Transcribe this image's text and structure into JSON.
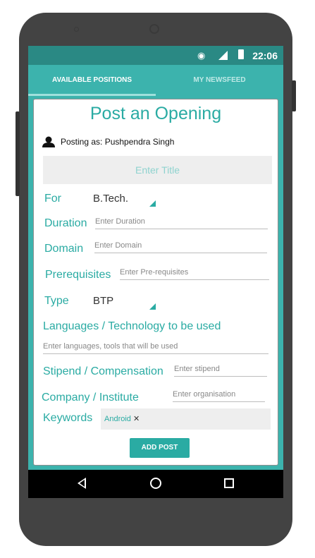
{
  "status_bar": {
    "time": "22:06"
  },
  "tabs": [
    {
      "label": "AVAILABLE POSITIONS",
      "active": true
    },
    {
      "label": "MY NEWSFEED",
      "active": false
    }
  ],
  "form": {
    "heading": "Post an Opening",
    "posting_as": "Posting as: Pushpendra Singh",
    "title_placeholder": "Enter Title",
    "for_label": "For",
    "for_value": "B.Tech.",
    "duration_label": "Duration",
    "duration_placeholder": "Enter Duration",
    "domain_label": "Domain",
    "domain_placeholder": "Enter Domain",
    "prereq_label": "Prerequisites",
    "prereq_placeholder": "Enter Pre-requisites",
    "type_label": "Type",
    "type_value": "BTP",
    "languages_label": "Languages / Technology to be used",
    "languages_placeholder": "Enter languages, tools that will be used",
    "stipend_label": "Stipend / Compensation",
    "stipend_placeholder": "Enter stipend",
    "company_label": "Company / Institute",
    "company_placeholder": "Enter organisation",
    "keywords_label": "Keywords",
    "keywords": [
      {
        "label": "Android"
      }
    ],
    "submit_label": "ADD POST"
  },
  "colors": {
    "accent": "#2aaba3",
    "toolbar": "#3cb3ad",
    "status_bar": "#2a8984"
  }
}
